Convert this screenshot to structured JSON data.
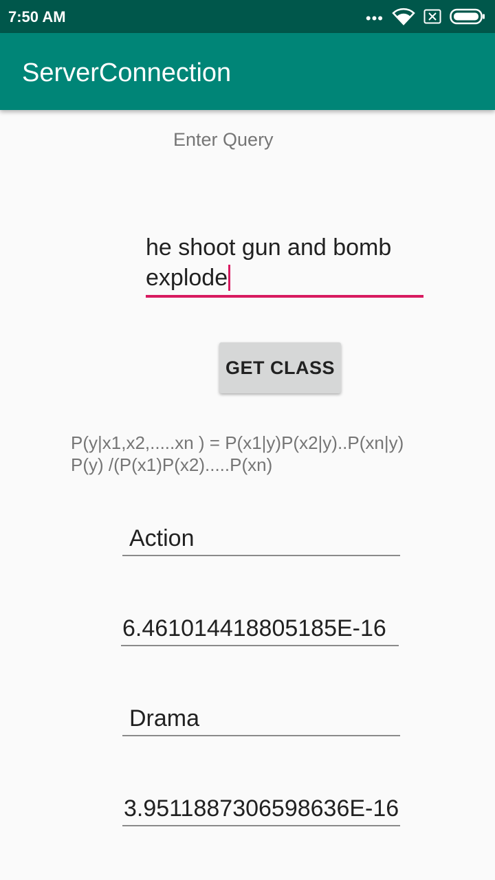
{
  "status_bar": {
    "time": "7:50 AM",
    "icons": [
      "more-dots-icon",
      "wifi-icon",
      "sim-none-icon",
      "battery-icon"
    ]
  },
  "app_bar": {
    "title": "ServerConnection",
    "color": "#008577"
  },
  "main": {
    "prompt_label": "Enter Query",
    "query_input": {
      "value": "he shoot gun and bomb explode",
      "accent_color": "#d81b60"
    },
    "get_class_button": "GET CLASS",
    "formula_line1": "P(y|x1,x2,.....xn ) = P(x1|y)P(x2|y)..P(xn|y)",
    "formula_line2": "P(y) /(P(x1)P(x2).....P(xn)",
    "results": {
      "class1_name": "Action",
      "class1_prob": "6.461014418805185E-16",
      "class2_name": "Drama",
      "class2_prob": "3.9511887306598636E-16"
    }
  }
}
